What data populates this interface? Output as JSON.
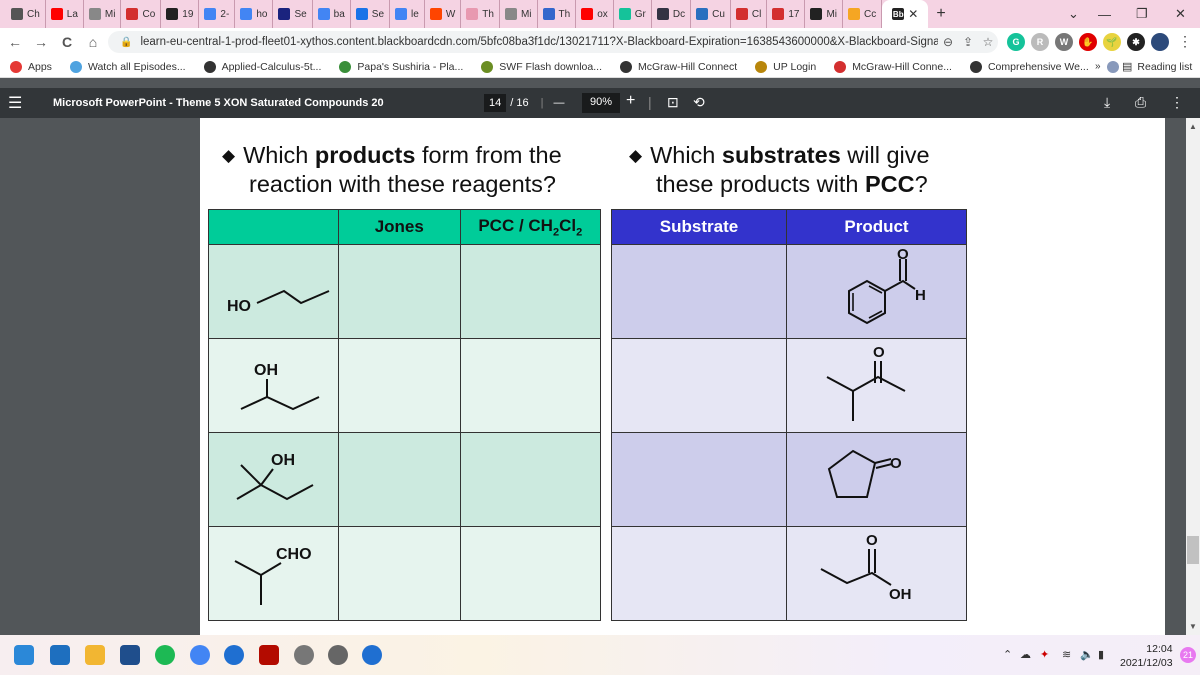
{
  "browser": {
    "tabs": [
      {
        "label": "Ch",
        "icon": "globe-icon",
        "color": "#555555"
      },
      {
        "label": "La",
        "icon": "youtube-icon",
        "color": "#ff0000"
      },
      {
        "label": "Mi",
        "icon": "doc-icon",
        "color": "#888888"
      },
      {
        "label": "Co",
        "icon": "mcgraw-icon",
        "color": "#d32f2f"
      },
      {
        "label": "19",
        "icon": "blackboard-icon",
        "color": "#222222"
      },
      {
        "label": "2-",
        "icon": "google-icon",
        "color": "#4285f4"
      },
      {
        "label": "ho",
        "icon": "google-icon",
        "color": "#4285f4"
      },
      {
        "label": "Se",
        "icon": "bing-icon",
        "color": "#1a237e"
      },
      {
        "label": "ba",
        "icon": "google-icon",
        "color": "#4285f4"
      },
      {
        "label": "Se",
        "icon": "settings-icon",
        "color": "#1a73e8"
      },
      {
        "label": "le",
        "icon": "google-icon",
        "color": "#4285f4"
      },
      {
        "label": "W",
        "icon": "reddit-icon",
        "color": "#ff4500"
      },
      {
        "label": "Th",
        "icon": "brain-icon",
        "color": "#e899b0"
      },
      {
        "label": "Mi",
        "icon": "doc-icon",
        "color": "#888888"
      },
      {
        "label": "Th",
        "icon": "site-icon",
        "color": "#3366cc"
      },
      {
        "label": "ox",
        "icon": "youtube-icon",
        "color": "#ff0000"
      },
      {
        "label": "Gr",
        "icon": "grammarly-icon",
        "color": "#15c39a"
      },
      {
        "label": "Dc",
        "icon": "m-icon",
        "color": "#334"
      },
      {
        "label": "Cu",
        "icon": "site-icon",
        "color": "#2a6fbf"
      },
      {
        "label": "Cl",
        "icon": "mcgraw-icon",
        "color": "#d32f2f"
      },
      {
        "label": "17",
        "icon": "mcgraw-icon",
        "color": "#d32f2f"
      },
      {
        "label": "Mi",
        "icon": "blackboard-icon",
        "color": "#222222"
      },
      {
        "label": "Cc",
        "icon": "pencil-icon",
        "color": "#f5a623"
      }
    ],
    "active_tab": {
      "label": "Bb",
      "icon": "blackboard-icon",
      "color": "#222222"
    },
    "new_tab_label": "+",
    "window_controls": {
      "tab_search": "⌄",
      "minimize": "—",
      "maximize": "❐",
      "close": "✕"
    },
    "url": "learn-eu-central-1-prod-fleet01-xythos.content.blackboardcdn.com/5bfc08ba3f1dc/13021711?X-Blackboard-Expiration=1638543600000&X-Blackboard-Signat...",
    "nav": {
      "back": "←",
      "forward": "→",
      "reload": "C",
      "home": "⌂"
    },
    "extensions": [
      {
        "name": "grammarly-extension",
        "glyph": "G",
        "color": "#15c39a"
      },
      {
        "name": "gray-extension",
        "glyph": "R",
        "color": "#bbbbbb"
      },
      {
        "name": "w-extension",
        "glyph": "W",
        "color": "#777777"
      },
      {
        "name": "adblock-extension",
        "glyph": "✋",
        "color": "#e00000"
      },
      {
        "name": "plant-extension",
        "glyph": "🌱",
        "color": "#e8d33f"
      },
      {
        "name": "puzzle-extension",
        "glyph": "✱",
        "color": "#222222"
      },
      {
        "name": "profile-avatar",
        "glyph": "",
        "color": "#2c4a7a"
      }
    ],
    "bookmarks": [
      {
        "label": "Apps",
        "icon": "apps-grid-icon",
        "color": "#e53935"
      },
      {
        "label": "Watch all Episodes...",
        "icon": "ticket-icon",
        "color": "#4fa3e0"
      },
      {
        "label": "Applied-Calculus-5t...",
        "icon": "globe-icon",
        "color": "#333333"
      },
      {
        "label": "Papa's Sushiria - Pla...",
        "icon": "game-icon",
        "color": "#3a8f3a"
      },
      {
        "label": "SWF Flash downloa...",
        "icon": "flash-icon",
        "color": "#6b8e23"
      },
      {
        "label": "McGraw-Hill Connect",
        "icon": "globe-icon",
        "color": "#333333"
      },
      {
        "label": "UP Login",
        "icon": "crest-icon",
        "color": "#b8860b"
      },
      {
        "label": "McGraw-Hill Conne...",
        "icon": "mcgraw-icon",
        "color": "#d32f2f"
      },
      {
        "label": "Comprehensive We...",
        "icon": "globe-icon",
        "color": "#333333"
      },
      {
        "label": "",
        "icon": "w-icon",
        "color": "#8899bb"
      }
    ],
    "bookmarks_overflow": "»",
    "reading_list": "Reading list"
  },
  "pdf_viewer": {
    "title": "Microsoft PowerPoint - Theme 5 XON Saturated Compounds 20",
    "current_page": "14",
    "total_pages": "/ 16",
    "zoom": "90%",
    "zoom_out": "—",
    "zoom_in": "+"
  },
  "slide": {
    "left_heading": {
      "pre": "Which ",
      "bold": "products",
      "post": " form from the",
      "line2": "reaction with these reagents?"
    },
    "right_heading": {
      "pre": "Which ",
      "bold": "substrates",
      "post": " will give",
      "line2_pre": "these products with ",
      "line2_bold": "PCC",
      "line2_post": "?"
    },
    "left_table": {
      "headers": [
        "",
        "Jones",
        "PCC / CH",
        "2",
        "Cl",
        "2"
      ],
      "header_color": "#00cc99",
      "rows": [
        {
          "structure": "1-propanol",
          "label": "HO"
        },
        {
          "structure": "2-butanol",
          "label": "OH"
        },
        {
          "structure": "2-methyl-2-butanol",
          "label": "OH"
        },
        {
          "structure": "2-methylpropanal",
          "label": "CHO"
        }
      ]
    },
    "right_table": {
      "headers": [
        "Substrate",
        "Product"
      ],
      "header_color": "#3333cc",
      "rows": [
        {
          "structure": "benzaldehyde",
          "labels": [
            "O",
            "H"
          ]
        },
        {
          "structure": "3-methyl-2-butanone",
          "labels": [
            "O"
          ]
        },
        {
          "structure": "cyclopentanone",
          "labels": [
            "O"
          ]
        },
        {
          "structure": "propanoic acid",
          "labels": [
            "O",
            "OH"
          ]
        }
      ]
    }
  },
  "taskbar": {
    "apps": [
      {
        "name": "start",
        "color": "#2b88d8"
      },
      {
        "name": "widgets",
        "color": "#1e6fbf"
      },
      {
        "name": "file-explorer",
        "color": "#f2b632"
      },
      {
        "name": "store",
        "color": "#1f4e8c"
      },
      {
        "name": "spotify",
        "color": "#1db954"
      },
      {
        "name": "chrome",
        "color": "#4285f4"
      },
      {
        "name": "app-a",
        "color": "#1f6fd1"
      },
      {
        "name": "acrobat",
        "color": "#b30b00"
      },
      {
        "name": "clock-app",
        "color": "#777777"
      },
      {
        "name": "settings",
        "color": "#666666"
      },
      {
        "name": "app-b",
        "color": "#1f6fd1"
      }
    ],
    "time": "12:04",
    "date": "2021/12/03",
    "notification_count": "21"
  }
}
